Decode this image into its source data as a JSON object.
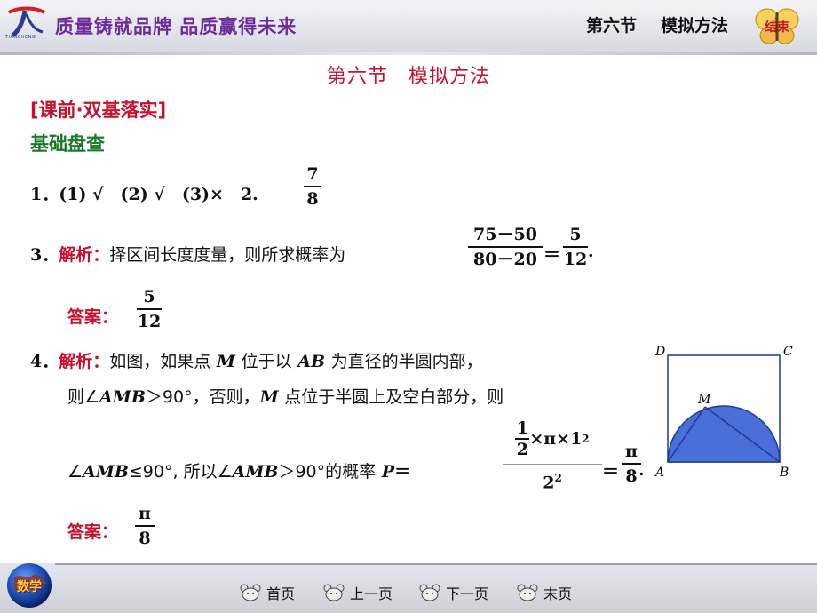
{
  "header": {
    "logo_sub": "TIANCHENG",
    "slogan": "质量铸就品牌  品质赢得未来",
    "section": "第六节",
    "title": "模拟方法",
    "end_label": "结束"
  },
  "content": {
    "page_title": "第六节　模拟方法",
    "section_red": "[课前·双基落实]",
    "section_green": "基础盘查",
    "q1": {
      "num": "1．",
      "parts": "(1) √　(2) √　(3)×　2.",
      "frac_n": "7",
      "frac_d": "8"
    },
    "q3": {
      "num": "3．",
      "label": "解析：",
      "text": "择区间长度度量，则所求概率为",
      "frac1_n": "75－50",
      "frac1_d": "80－20",
      "eq": "＝",
      "frac2_n": "5",
      "frac2_d": "12",
      "end": ".",
      "answer_label": "答案：",
      "answer_n": "5",
      "answer_d": "12"
    },
    "q4": {
      "num": "4．",
      "label": "解析：",
      "l1a": "如图，如果点",
      "m1": "M",
      "l1b": "位于以",
      "ab": "AB",
      "l1c": "为直径的半圆内部，",
      "l2a": "则∠",
      "amb1": "AMB",
      "l2b": "＞90°，否则，",
      "m2": "M",
      "l2c": "点位于半圆上及空白部分，则",
      "l3a": "∠",
      "amb2": "AMB",
      "l3b": "≤90°, 所以∠",
      "amb3": "AMB",
      "l3c": "＞90°的概率",
      "p": "P",
      "eq1": "＝",
      "big_half_n": "1",
      "big_half_d": "2",
      "big_mid": "×π×1",
      "big_sup": "2",
      "big_den": "2",
      "big_den_sup": "2",
      "eq2": "＝",
      "res_n": "π",
      "res_d": "8",
      "end": ".",
      "answer_label": "答案：",
      "answer_n": "π",
      "answer_d": "8"
    },
    "figure": {
      "D": "D",
      "C": "C",
      "M": "M",
      "A": "A",
      "B": "B",
      "fill_color": "#4a6fd6",
      "line_color": "#1e3a9a"
    }
  },
  "footer": {
    "logo_label": "数学",
    "nav": [
      "首页",
      "上一页",
      "下一页",
      "末页"
    ]
  }
}
